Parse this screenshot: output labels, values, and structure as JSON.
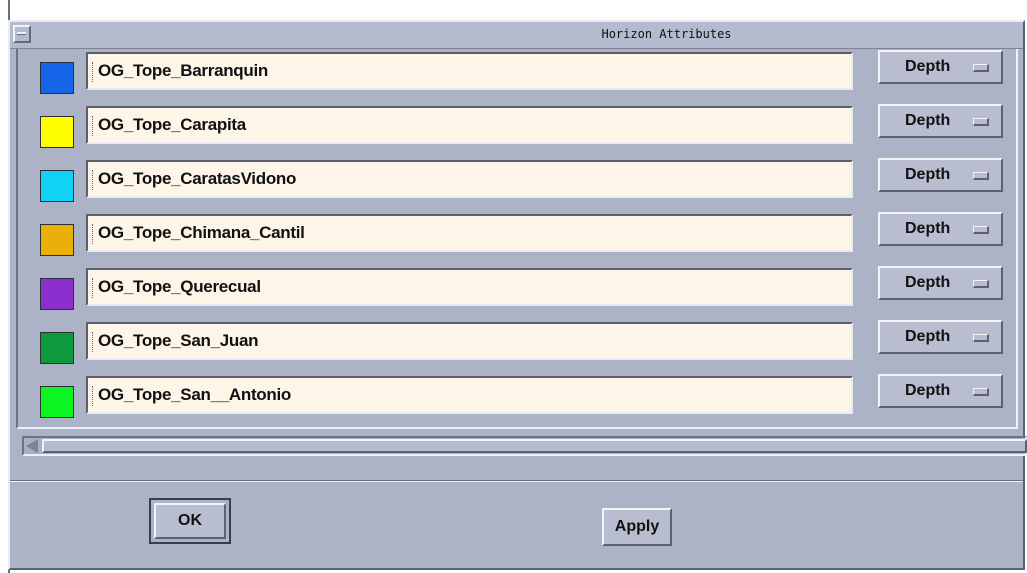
{
  "window": {
    "title": "Horizon Attributes"
  },
  "horizons": [
    {
      "name": "OG_Tope_Barranquin",
      "color": "#1565e8",
      "attribute": "Depth"
    },
    {
      "name": "OG_Tope_Carapita",
      "color": "#ffff00",
      "attribute": "Depth"
    },
    {
      "name": "OG_Tope_CaratasVidono",
      "color": "#10d2f5",
      "attribute": "Depth"
    },
    {
      "name": "OG_Tope_Chimana_Cantil",
      "color": "#eab00a",
      "attribute": "Depth"
    },
    {
      "name": "OG_Tope_Querecual",
      "color": "#8c2fcf",
      "attribute": "Depth"
    },
    {
      "name": "OG_Tope_San_Juan",
      "color": "#0c9a3c",
      "attribute": "Depth"
    },
    {
      "name": "OG_Tope_San__Antonio",
      "color": "#0cf521",
      "attribute": "Depth"
    }
  ],
  "buttons": {
    "ok": "OK",
    "apply": "Apply"
  },
  "icons": {
    "window_menu": "window-menu-icon",
    "option_indicator": "option-menu-indicator-icon",
    "scroll_left": "arrow-left-icon"
  }
}
